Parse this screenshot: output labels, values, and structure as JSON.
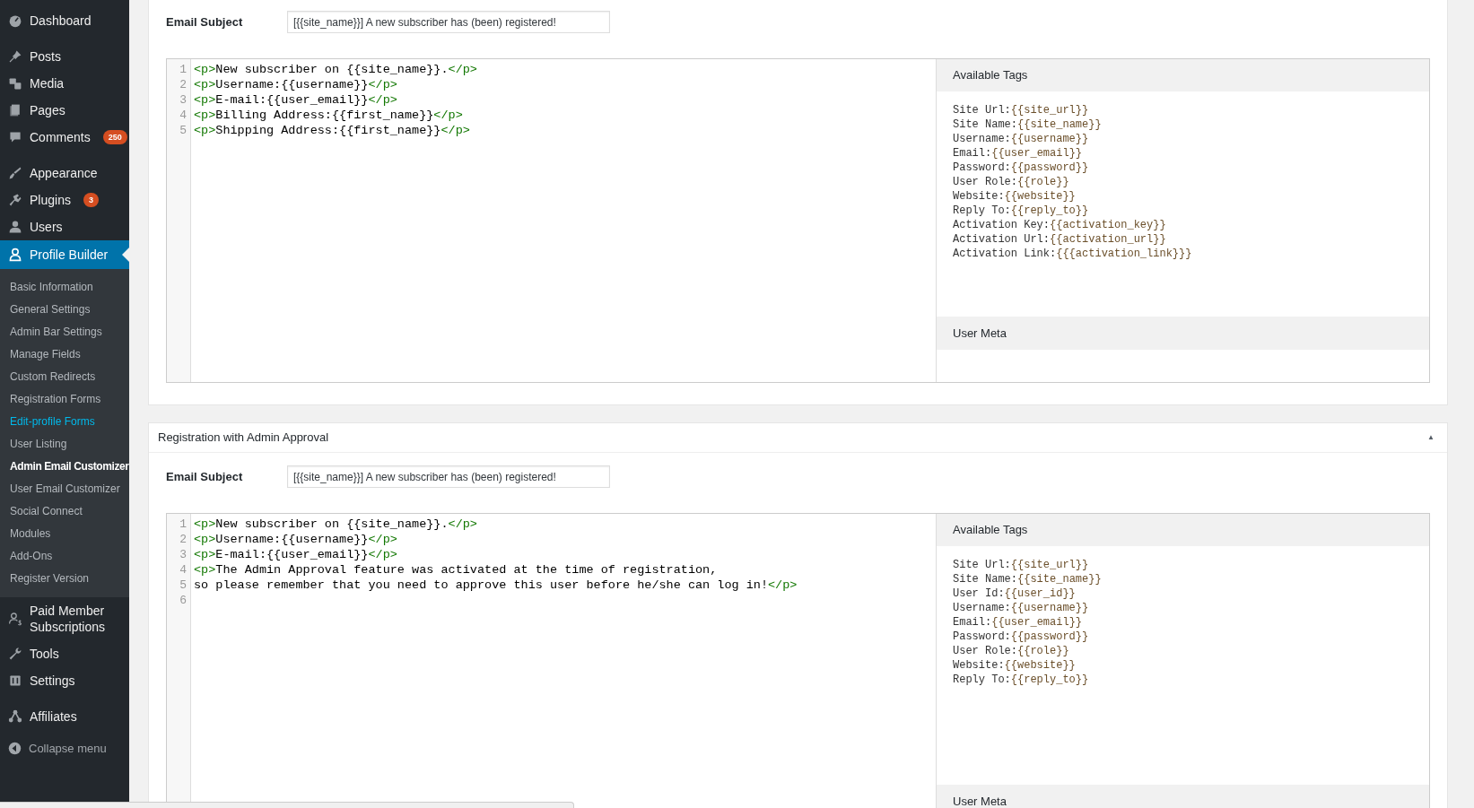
{
  "sidebar": {
    "groups": [
      [
        {
          "label": "Dashboard",
          "selected": false
        }
      ],
      [
        {
          "label": "Posts",
          "selected": false
        },
        {
          "label": "Media",
          "selected": false
        },
        {
          "label": "Pages",
          "selected": false
        },
        {
          "label": "Comments",
          "badge": "250",
          "selected": false
        }
      ],
      [
        {
          "label": "Appearance",
          "selected": false
        },
        {
          "label": "Plugins",
          "badge": "3",
          "selected": false
        },
        {
          "label": "Users",
          "selected": false
        },
        {
          "label": "Profile Builder",
          "selected": true,
          "submenu": [
            {
              "label": "Basic Information",
              "selected": false,
              "hovered": false
            },
            {
              "label": "General Settings",
              "selected": false,
              "hovered": false
            },
            {
              "label": "Admin Bar Settings",
              "selected": false,
              "hovered": false
            },
            {
              "label": "Manage Fields",
              "selected": false,
              "hovered": false
            },
            {
              "label": "Custom Redirects",
              "selected": false,
              "hovered": false
            },
            {
              "label": "Registration Forms",
              "selected": false,
              "hovered": false
            },
            {
              "label": "Edit-profile Forms",
              "selected": false,
              "hovered": true
            },
            {
              "label": "User Listing",
              "selected": false,
              "hovered": false
            },
            {
              "label": "Admin Email Customizer",
              "selected": true,
              "hovered": false
            },
            {
              "label": "User Email Customizer",
              "selected": false,
              "hovered": false
            },
            {
              "label": "Social Connect",
              "selected": false,
              "hovered": false
            },
            {
              "label": "Modules",
              "selected": false,
              "hovered": false
            },
            {
              "label": "Add-Ons",
              "selected": false,
              "hovered": false
            },
            {
              "label": "Register Version",
              "selected": false,
              "hovered": false
            }
          ]
        },
        {
          "label": "Paid Member Subscriptions",
          "selected": false
        },
        {
          "label": "Tools",
          "selected": false
        },
        {
          "label": "Settings",
          "selected": false
        }
      ],
      [
        {
          "label": "Affiliates",
          "selected": false
        }
      ]
    ],
    "collapse": {
      "label": "Collapse menu"
    }
  },
  "sections": [
    {
      "email_subject": {
        "label": "Email Subject",
        "value": "[{{site_name}}] A new subscriber has (been) registered!"
      },
      "editor": {
        "lines": [
          {
            "number": "1",
            "segments": [
              {
                "kind": "tag",
                "text": "<p>"
              },
              {
                "kind": "text",
                "text": "New subscriber on {{site_name}}."
              },
              {
                "kind": "tag",
                "text": "</p>"
              }
            ]
          },
          {
            "number": "2",
            "segments": [
              {
                "kind": "tag",
                "text": "<p>"
              },
              {
                "kind": "text",
                "text": "Username:{{username}}"
              },
              {
                "kind": "tag",
                "text": "</p>"
              }
            ]
          },
          {
            "number": "3",
            "segments": [
              {
                "kind": "tag",
                "text": "<p>"
              },
              {
                "kind": "text",
                "text": "E-mail:{{user_email}}"
              },
              {
                "kind": "tag",
                "text": "</p>"
              }
            ]
          },
          {
            "number": "4",
            "segments": [
              {
                "kind": "tag",
                "text": "<p>"
              },
              {
                "kind": "text",
                "text": "Billing Address:{{first_name}}"
              },
              {
                "kind": "tag",
                "text": "</p>"
              }
            ]
          },
          {
            "number": "5",
            "segments": [
              {
                "kind": "tag",
                "text": "<p>"
              },
              {
                "kind": "text",
                "text": "Shipping Address:{{first_name}}"
              },
              {
                "kind": "tag",
                "text": "</p>"
              }
            ]
          }
        ]
      },
      "available_tags": {
        "title": "Available Tags",
        "tags": [
          {
            "name": "Site Url:",
            "tag": "{{site_url}}"
          },
          {
            "name": "Site Name:",
            "tag": "{{site_name}}"
          },
          {
            "name": "Username:",
            "tag": "{{username}}"
          },
          {
            "name": "Email:",
            "tag": "{{user_email}}"
          },
          {
            "name": "Password:",
            "tag": "{{password}}"
          },
          {
            "name": "User Role:",
            "tag": "{{role}}"
          },
          {
            "name": "Website:",
            "tag": "{{website}}"
          },
          {
            "name": "Reply To:",
            "tag": "{{reply_to}}"
          },
          {
            "name": "Activation Key:",
            "tag": "{{activation_key}}"
          },
          {
            "name": "Activation Url:",
            "tag": "{{activation_url}}"
          },
          {
            "name": "Activation Link:",
            "tag": "{{{activation_link}}}"
          }
        ]
      },
      "user_meta": {
        "title": "User Meta"
      }
    },
    {
      "title": "Registration with Admin Approval",
      "toggle": "▲",
      "email_subject": {
        "label": "Email Subject",
        "value": "[{{site_name}}] A new subscriber has (been) registered!"
      },
      "editor": {
        "lines": [
          {
            "number": "1",
            "segments": [
              {
                "kind": "tag",
                "text": "<p>"
              },
              {
                "kind": "text",
                "text": "New subscriber on {{site_name}}."
              },
              {
                "kind": "tag",
                "text": "</p>"
              }
            ]
          },
          {
            "number": "2",
            "segments": [
              {
                "kind": "tag",
                "text": "<p>"
              },
              {
                "kind": "text",
                "text": "Username:{{username}}"
              },
              {
                "kind": "tag",
                "text": "</p>"
              }
            ]
          },
          {
            "number": "3",
            "segments": [
              {
                "kind": "tag",
                "text": "<p>"
              },
              {
                "kind": "text",
                "text": "E-mail:{{user_email}}"
              },
              {
                "kind": "tag",
                "text": "</p>"
              }
            ]
          },
          {
            "number": "4",
            "segments": [
              {
                "kind": "tag",
                "text": "<p>"
              },
              {
                "kind": "text",
                "text": "The Admin Approval feature was activated at the time of registration,"
              }
            ]
          },
          {
            "number": "5",
            "segments": [
              {
                "kind": "text",
                "text": "so please remember that you need to approve this user before he/she can log in!"
              },
              {
                "kind": "tag",
                "text": "</p>"
              }
            ]
          },
          {
            "number": "6"
          }
        ]
      },
      "available_tags": {
        "title": "Available Tags",
        "tags": [
          {
            "name": "Site Url:",
            "tag": "{{site_url}}"
          },
          {
            "name": "Site Name:",
            "tag": "{{site_name}}"
          },
          {
            "name": "User Id:",
            "tag": "{{user_id}}"
          },
          {
            "name": "Username:",
            "tag": "{{username}}"
          },
          {
            "name": "Email:",
            "tag": "{{user_email}}"
          },
          {
            "name": "Password:",
            "tag": "{{password}}"
          },
          {
            "name": "User Role:",
            "tag": "{{role}}"
          },
          {
            "name": "Website:",
            "tag": "{{website}}"
          },
          {
            "name": "Reply To:",
            "tag": "{{reply_to}}"
          }
        ]
      },
      "user_meta": {
        "title": "User Meta"
      }
    }
  ]
}
